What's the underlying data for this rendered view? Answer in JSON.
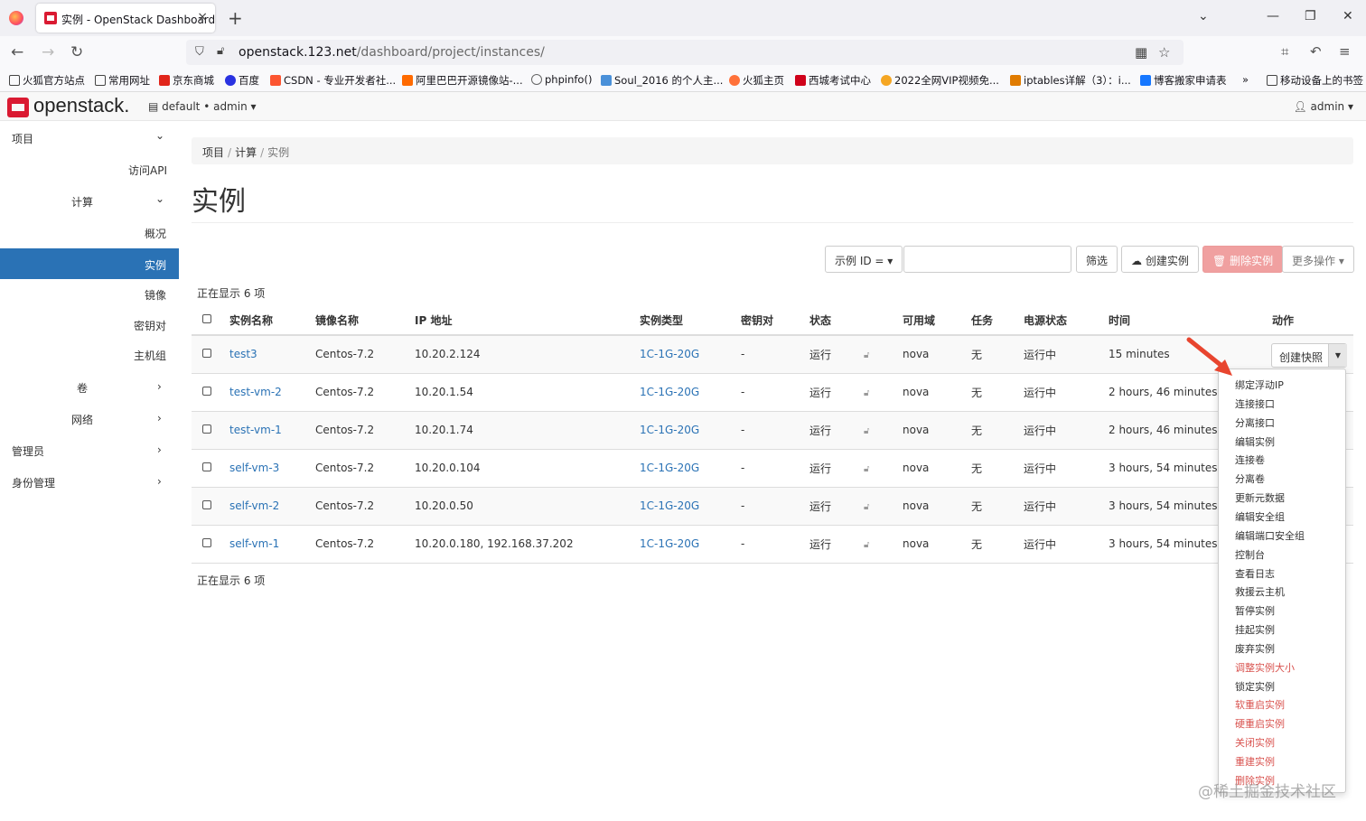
{
  "browser": {
    "tab_title": "实例 - OpenStack Dashboard",
    "tab_close": "×",
    "new_tab": "+",
    "url_host": "openstack.123.net",
    "url_path": "/dashboard/project/instances/",
    "bookmarks": [
      {
        "label": "火狐官方站点",
        "color": "#ff7139"
      },
      {
        "label": "常用网址",
        "color": "#888888"
      },
      {
        "label": "京东商城",
        "color": "#e1251b"
      },
      {
        "label": "百度",
        "color": "#2932e1"
      },
      {
        "label": "CSDN - 专业开发者社...",
        "color": "#fc5531"
      },
      {
        "label": "阿里巴巴开源镜像站-...",
        "color": "#ff6a00"
      },
      {
        "label": "phpinfo()",
        "color": "#666666"
      },
      {
        "label": "Soul_2016 的个人主...",
        "color": "#4a90d9"
      },
      {
        "label": "火狐主页",
        "color": "#ff7139"
      },
      {
        "label": "西城考试中心",
        "color": "#d0021b"
      },
      {
        "label": "2022全网VIP视频免...",
        "color": "#f5a623"
      },
      {
        "label": "iptables详解（3）：i...",
        "color": "#e07b00"
      },
      {
        "label": "博客搬家申请表",
        "color": "#1677ff"
      },
      {
        "label": "移动设备上的书签",
        "color": "#555555"
      }
    ]
  },
  "header": {
    "logo": "openstack.",
    "context": "default • admin",
    "user": "admin"
  },
  "sidebar": {
    "project": "项目",
    "api_access": "访问API",
    "compute": "计算",
    "overview": "概况",
    "instances": "实例",
    "images": "镜像",
    "keypairs": "密钥对",
    "server_groups": "主机组",
    "volumes": "卷",
    "network": "网络",
    "admin": "管理员",
    "identity": "身份管理"
  },
  "breadcrumb": {
    "a": "项目",
    "b": "计算",
    "c": "实例",
    "sep": "/"
  },
  "page_title": "实例",
  "toolbar": {
    "filter_field": "示例 ID =",
    "filter_button": "筛选",
    "create_button": "创建实例",
    "delete_button": "删除实例",
    "more_button": "更多操作"
  },
  "count_text": "正在显示 6 项",
  "table": {
    "headers": {
      "name": "实例名称",
      "image": "镜像名称",
      "ip": "IP 地址",
      "flavor": "实例类型",
      "keypair": "密钥对",
      "status": "状态",
      "az": "可用域",
      "task": "任务",
      "power": "电源状态",
      "time": "时间",
      "actions": "动作"
    },
    "rows": [
      {
        "name": "test3",
        "image": "Centos-7.2",
        "ip": "10.20.2.124",
        "flavor": "1C-1G-20G",
        "keypair": "-",
        "status": "运行",
        "az": "nova",
        "task": "无",
        "power": "运行中",
        "time": "15 minutes"
      },
      {
        "name": "test-vm-2",
        "image": "Centos-7.2",
        "ip": "10.20.1.54",
        "flavor": "1C-1G-20G",
        "keypair": "-",
        "status": "运行",
        "az": "nova",
        "task": "无",
        "power": "运行中",
        "time": "2 hours, 46 minutes"
      },
      {
        "name": "test-vm-1",
        "image": "Centos-7.2",
        "ip": "10.20.1.74",
        "flavor": "1C-1G-20G",
        "keypair": "-",
        "status": "运行",
        "az": "nova",
        "task": "无",
        "power": "运行中",
        "time": "2 hours, 46 minutes"
      },
      {
        "name": "self-vm-3",
        "image": "Centos-7.2",
        "ip": "10.20.0.104",
        "flavor": "1C-1G-20G",
        "keypair": "-",
        "status": "运行",
        "az": "nova",
        "task": "无",
        "power": "运行中",
        "time": "3 hours, 54 minutes"
      },
      {
        "name": "self-vm-2",
        "image": "Centos-7.2",
        "ip": "10.20.0.50",
        "flavor": "1C-1G-20G",
        "keypair": "-",
        "status": "运行",
        "az": "nova",
        "task": "无",
        "power": "运行中",
        "time": "3 hours, 54 minutes"
      },
      {
        "name": "self-vm-1",
        "image": "Centos-7.2",
        "ip": "10.20.0.180, 192.168.37.202",
        "flavor": "1C-1G-20G",
        "keypair": "-",
        "status": "运行",
        "az": "nova",
        "task": "无",
        "power": "运行中",
        "time": "3 hours, 54 minutes"
      }
    ]
  },
  "actions": {
    "snapshot": "创建快照",
    "menu": [
      {
        "label": "绑定浮动IP",
        "danger": false
      },
      {
        "label": "连接接口",
        "danger": false
      },
      {
        "label": "分离接口",
        "danger": false
      },
      {
        "label": "编辑实例",
        "danger": false
      },
      {
        "label": "连接卷",
        "danger": false
      },
      {
        "label": "分离卷",
        "danger": false
      },
      {
        "label": "更新元数据",
        "danger": false
      },
      {
        "label": "编辑安全组",
        "danger": false
      },
      {
        "label": "编辑端口安全组",
        "danger": false
      },
      {
        "label": "控制台",
        "danger": false
      },
      {
        "label": "查看日志",
        "danger": false
      },
      {
        "label": "救援云主机",
        "danger": false
      },
      {
        "label": "暂停实例",
        "danger": false
      },
      {
        "label": "挂起实例",
        "danger": false
      },
      {
        "label": "废弃实例",
        "danger": false
      },
      {
        "label": "调整实例大小",
        "danger": true
      },
      {
        "label": "锁定实例",
        "danger": false
      },
      {
        "label": "软重启实例",
        "danger": true
      },
      {
        "label": "硬重启实例",
        "danger": true
      },
      {
        "label": "关闭实例",
        "danger": true
      },
      {
        "label": "重建实例",
        "danger": true
      },
      {
        "label": "删除实例",
        "danger": true
      }
    ]
  },
  "watermark": "@稀土掘金技术社区",
  "colors": {
    "accent": "#2a72b5",
    "danger": "#d9534f",
    "brand": "#da1a32",
    "arrow": "#e8452f"
  }
}
